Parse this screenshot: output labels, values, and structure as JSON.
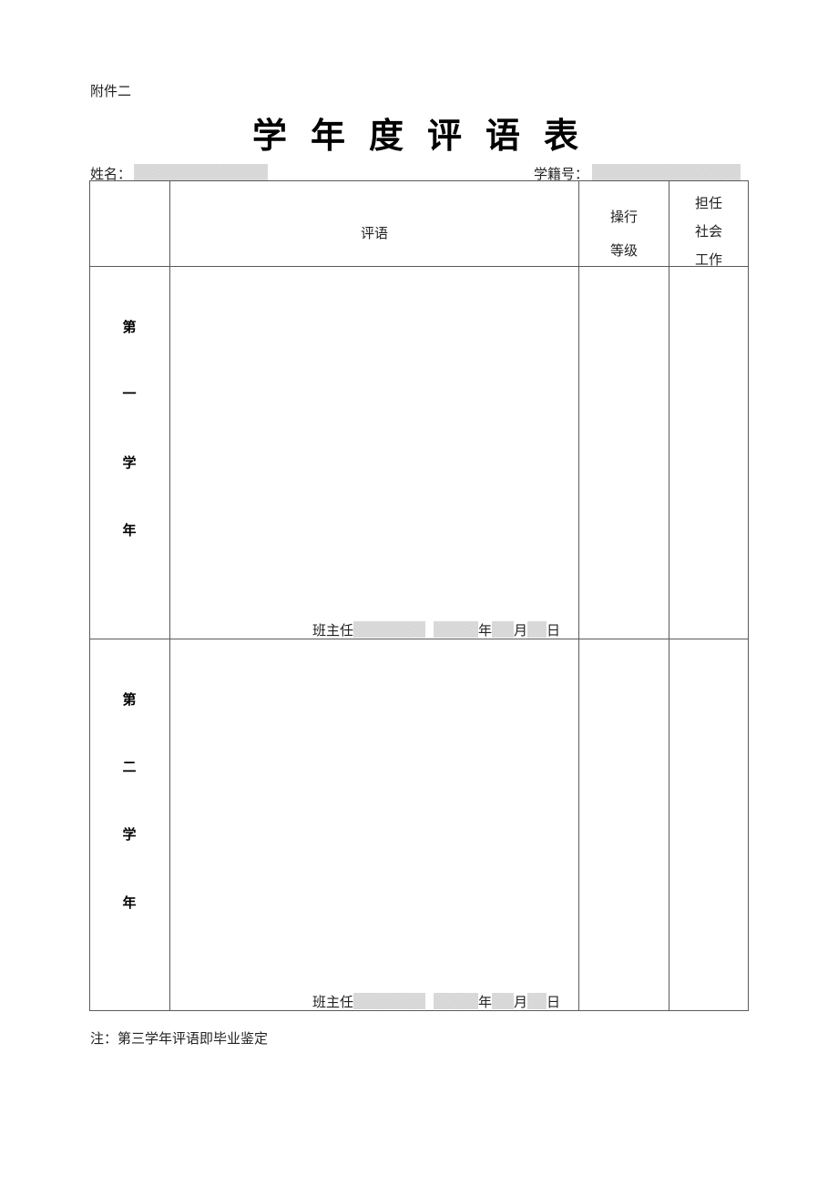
{
  "annex_label": "附件二",
  "title": "学年度评语表",
  "header_fields": {
    "name_label": "姓名：",
    "name_value": "",
    "student_id_label": "学籍号：",
    "student_id_value": ""
  },
  "table": {
    "columns": {
      "year": "",
      "comment": "评语",
      "conduct_grade": [
        "操行",
        "等级"
      ],
      "social_work": [
        "担任",
        "社会",
        "工作"
      ]
    },
    "rows": [
      {
        "year_label_chars": [
          "第",
          "一",
          "学",
          "年"
        ],
        "comment": "",
        "conduct_grade": "",
        "social_work": "",
        "signature": {
          "teacher_label": "班主任",
          "teacher_value": "",
          "year_value": "",
          "year_label": "年",
          "month_value": "",
          "month_label": "月",
          "day_value": "",
          "day_label": "日"
        }
      },
      {
        "year_label_chars": [
          "第",
          "二",
          "学",
          "年"
        ],
        "comment": "",
        "conduct_grade": "",
        "social_work": "",
        "signature": {
          "teacher_label": "班主任",
          "teacher_value": "",
          "year_value": "",
          "year_label": "年",
          "month_value": "",
          "month_label": "月",
          "day_value": "",
          "day_label": "日"
        }
      }
    ]
  },
  "note": "注：第三学年评语即毕业鉴定"
}
